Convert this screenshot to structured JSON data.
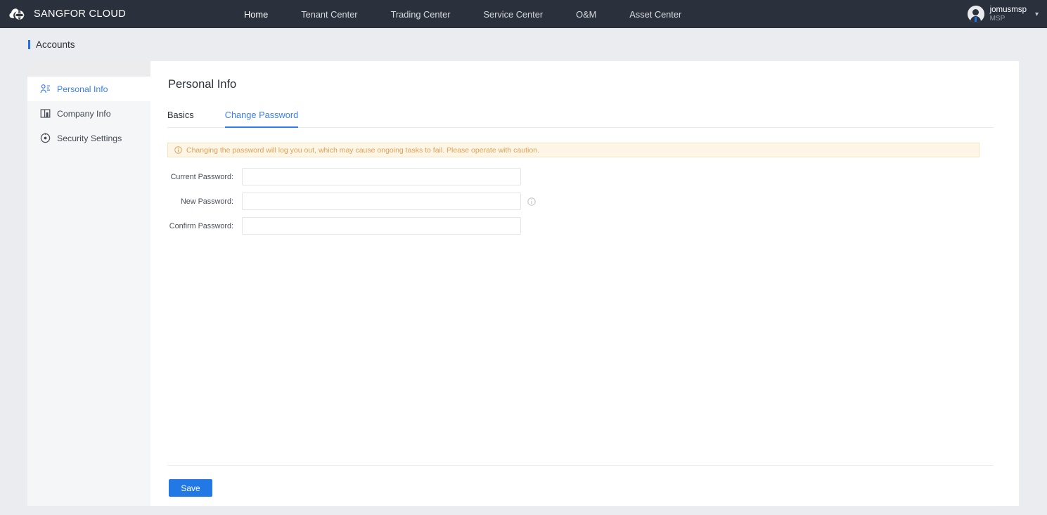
{
  "header": {
    "brand": "SANGFOR CLOUD",
    "logo_icon": "cloud-globe-icon",
    "nav": [
      {
        "label": "Home",
        "active": true
      },
      {
        "label": "Tenant Center",
        "active": false
      },
      {
        "label": "Trading Center",
        "active": false
      },
      {
        "label": "Service Center",
        "active": false
      },
      {
        "label": "O&M",
        "active": false
      },
      {
        "label": "Asset Center",
        "active": false
      }
    ],
    "user": {
      "name": "jomusmsp",
      "role": "MSP",
      "avatar_icon": "user-avatar-icon",
      "caret_icon": "chevron-down-icon"
    }
  },
  "breadcrumb": {
    "text": "Accounts"
  },
  "sidebar": {
    "items": [
      {
        "label": "Personal Info",
        "icon": "user-profile-icon",
        "active": true
      },
      {
        "label": "Company Info",
        "icon": "building-icon",
        "active": false
      },
      {
        "label": "Security Settings",
        "icon": "shield-target-icon",
        "active": false
      }
    ]
  },
  "main": {
    "title": "Personal Info",
    "tabs": [
      {
        "label": "Basics",
        "active": false
      },
      {
        "label": "Change Password",
        "active": true
      }
    ],
    "warning": {
      "icon": "info-circle-icon",
      "text": "Changing the password will log you out, which may cause ongoing tasks to fail. Please operate with caution."
    },
    "form": {
      "fields": [
        {
          "label": "Current Password:",
          "value": "",
          "placeholder": "",
          "hint_icon": null
        },
        {
          "label": "New Password:",
          "value": "",
          "placeholder": "",
          "hint_icon": "info-circle-icon"
        },
        {
          "label": "Confirm Password:",
          "value": "",
          "placeholder": "",
          "hint_icon": null
        }
      ]
    },
    "save_label": "Save"
  },
  "colors": {
    "topbar_bg": "#2b313c",
    "accent": "#2279e6",
    "link": "#3a7ef0",
    "warning_bg": "#fdf6e7",
    "warning_text": "#e0a052",
    "page_bg": "#ebecef"
  }
}
